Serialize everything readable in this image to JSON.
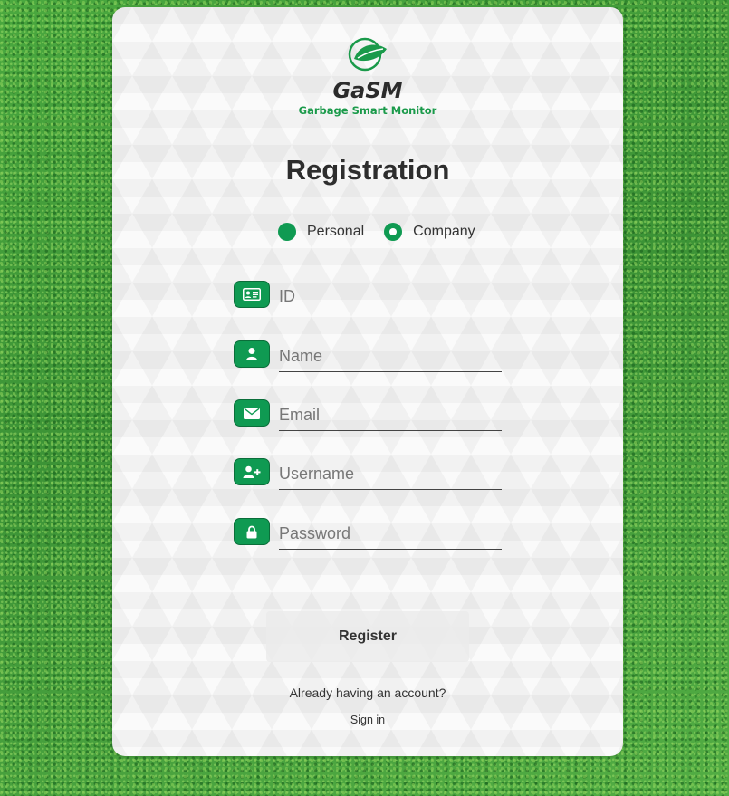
{
  "brand": {
    "name": "GaSM",
    "tagline": "Garbage Smart Monitor",
    "accent_color": "#0f9a52"
  },
  "page": {
    "title": "Registration"
  },
  "account_type": {
    "options": [
      {
        "label": "Personal",
        "selected": false
      },
      {
        "label": "Company",
        "selected": true
      }
    ]
  },
  "fields": [
    {
      "icon": "id-card-icon",
      "placeholder": "ID",
      "value": ""
    },
    {
      "icon": "user-icon",
      "placeholder": "Name",
      "value": ""
    },
    {
      "icon": "envelope-icon",
      "placeholder": "Email",
      "value": ""
    },
    {
      "icon": "user-plus-icon",
      "placeholder": "Username",
      "value": ""
    },
    {
      "icon": "lock-icon",
      "placeholder": "Password",
      "value": ""
    }
  ],
  "actions": {
    "register_label": "Register",
    "already_text": "Already having an account?",
    "signin_label": "Sign in"
  }
}
